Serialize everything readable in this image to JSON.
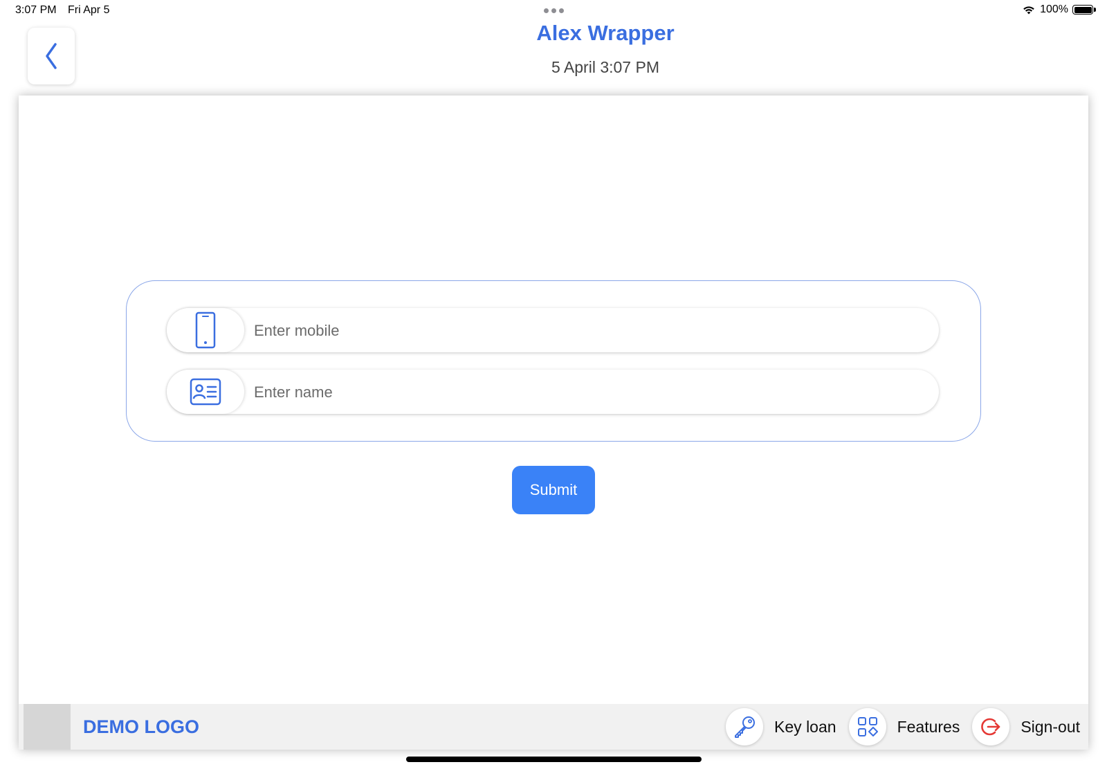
{
  "status_bar": {
    "time": "3:07 PM",
    "date": "Fri Apr 5",
    "battery": "100%",
    "wifi_icon": "wifi-icon",
    "battery_icon": "battery-icon"
  },
  "header": {
    "back_icon": "chevron-left-icon",
    "title": "Alex Wrapper",
    "subtitle": "5 April 3:07 PM"
  },
  "form": {
    "mobile": {
      "icon": "mobile-phone-icon",
      "placeholder": "Enter mobile",
      "value": ""
    },
    "name": {
      "icon": "id-card-icon",
      "placeholder": "Enter name",
      "value": ""
    },
    "submit_label": "Submit"
  },
  "footer": {
    "logo_text": "DEMO LOGO",
    "nav": [
      {
        "label": "Key loan",
        "icon": "key-icon"
      },
      {
        "label": "Features",
        "icon": "grid-icon"
      },
      {
        "label": "Sign-out",
        "icon": "sign-out-icon"
      }
    ]
  },
  "colors": {
    "accent": "#3a6ee0",
    "submit": "#3a82f7",
    "signout": "#e53935",
    "card_border": "#8aa6e8",
    "footer_bg": "#f1f1f1"
  }
}
